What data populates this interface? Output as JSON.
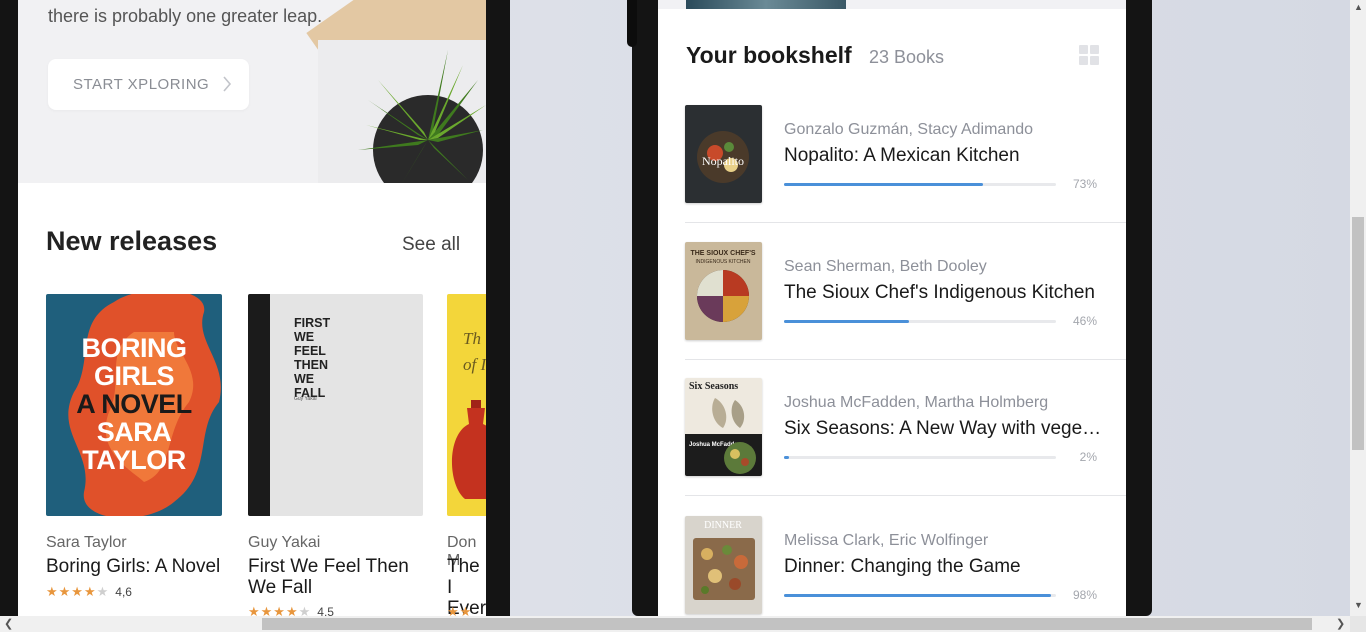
{
  "explore": {
    "hero_text": "there is probably one greater leap.",
    "start_button": "START XPLORING"
  },
  "new_releases": {
    "title": "New releases",
    "see_all": "See all",
    "books": [
      {
        "author": "Sara Taylor",
        "title": "Boring Girls: A Novel",
        "rating": "4,6",
        "stars": 4,
        "cover_lines": [
          "BORING",
          "GIRLS",
          "A NOVEL",
          "SARA",
          "TAYLOR"
        ]
      },
      {
        "author": "Guy Yakai",
        "title": "First We Feel Then We Fall",
        "rating": "4,5",
        "stars": 4,
        "cover_lines": [
          "FIRST",
          "WE",
          "FEEL",
          "THEN",
          "WE",
          "FALL"
        ],
        "cover_author": "Guy Yakai"
      },
      {
        "author": "Don M",
        "title": "The I Every",
        "cover_lines": [
          "Th",
          "of I"
        ]
      }
    ]
  },
  "bookshelf": {
    "title": "Your bookshelf",
    "count": "23 Books",
    "books": [
      {
        "authors": "Gonzalo Guzmán, Stacy Adimando",
        "title": "Nopalito: A Mexican Kitchen",
        "progress": 73,
        "progress_label": "73%",
        "cover_text": "Nopalito"
      },
      {
        "authors": "Sean Sherman, Beth Dooley",
        "title": "The Sioux Chef's Indigenous Kitchen",
        "progress": 46,
        "progress_label": "46%",
        "cover_text": "THE SIOUX CHEF'S INDIGENOUS KITCHEN"
      },
      {
        "authors": "Joshua McFadden, Martha Holmberg",
        "title": "Six Seasons: A New Way with vegetables",
        "progress": 2,
        "progress_label": "2%",
        "cover_text": "Six Seasons",
        "cover_author": "Joshua McFadden"
      },
      {
        "authors": "Melissa Clark, Eric Wolfinger",
        "title": "Dinner: Changing the Game",
        "progress": 98,
        "progress_label": "98%",
        "cover_text": "DINNER"
      }
    ]
  },
  "colors": {
    "accent": "#4a90d9",
    "star": "#e8963d",
    "muted": "#8d9099"
  }
}
